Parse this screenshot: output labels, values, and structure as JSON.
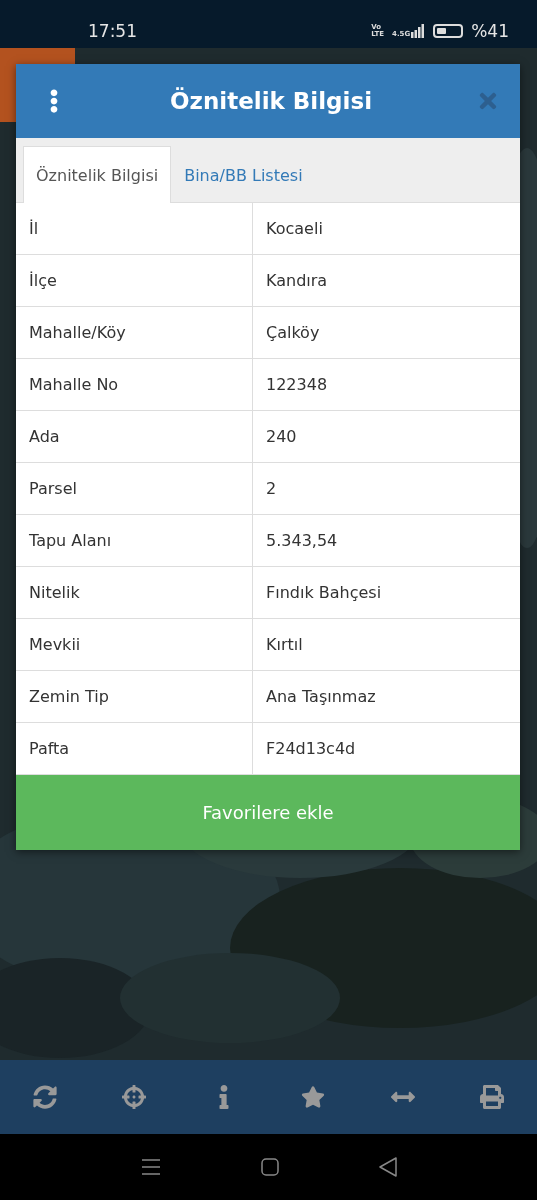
{
  "status_bar": {
    "time": "17:51",
    "volte": [
      "Vo",
      "LTE"
    ],
    "network": "4.5G",
    "battery": "%41"
  },
  "dialog": {
    "title": "Öznitelik Bilgisi",
    "tabs": [
      {
        "label": "Öznitelik Bilgisi",
        "selected": true
      },
      {
        "label": "Bina/BB Listesi",
        "selected": false
      }
    ],
    "rows": [
      {
        "label": "İl",
        "value": "Kocaeli"
      },
      {
        "label": "İlçe",
        "value": "Kandıra"
      },
      {
        "label": "Mahalle/Köy",
        "value": "Çalköy"
      },
      {
        "label": "Mahalle No",
        "value": "122348"
      },
      {
        "label": "Ada",
        "value": "240"
      },
      {
        "label": "Parsel",
        "value": "2"
      },
      {
        "label": "Tapu Alanı",
        "value": "5.343,54"
      },
      {
        "label": "Nitelik",
        "value": "Fındık Bahçesi"
      },
      {
        "label": "Mevkii",
        "value": "Kırtıl"
      },
      {
        "label": "Zemin Tip",
        "value": "Ana Taşınmaz"
      },
      {
        "label": "Pafta",
        "value": "F24d13c4d"
      }
    ],
    "button": "Favorilere ekle"
  },
  "toolbar": [
    {
      "kind": "refresh"
    },
    {
      "kind": "locate"
    },
    {
      "kind": "info"
    },
    {
      "kind": "favorite"
    },
    {
      "kind": "measure"
    },
    {
      "kind": "print"
    }
  ],
  "nav_bar": [
    {
      "kind": "menu"
    },
    {
      "kind": "home"
    },
    {
      "kind": "back"
    }
  ]
}
